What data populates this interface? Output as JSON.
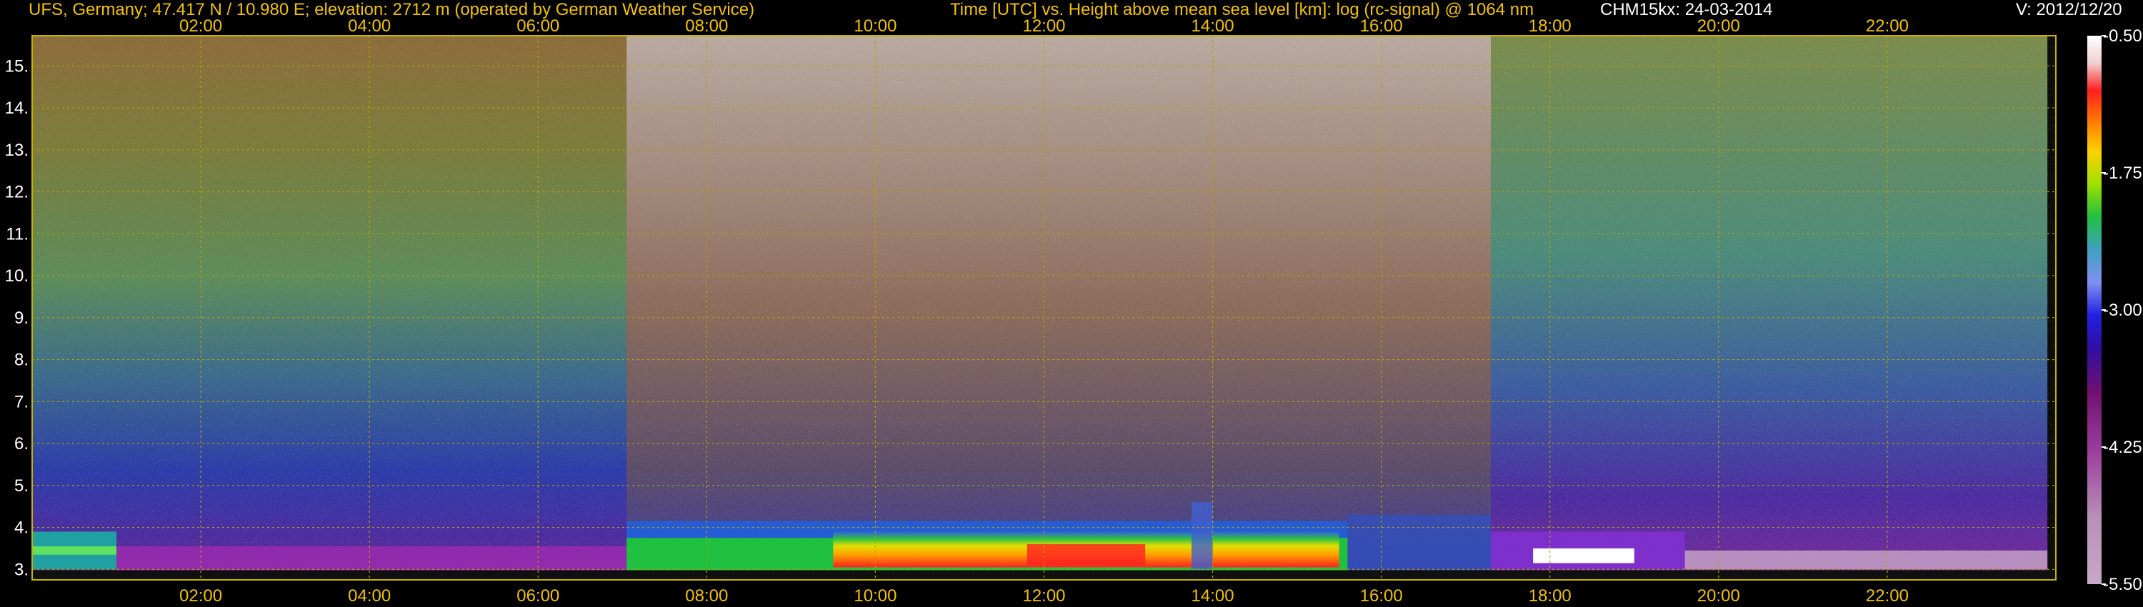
{
  "header": {
    "station": "UFS, Germany; 47.417 N / 10.980 E; elevation: 2712 m  (operated by German Weather Service)",
    "description": "Time [UTC] vs. Height above mean sea level [km]: log (rc-signal) @ 1064 nm",
    "instrument_date": "CHM15kx: 24-03-2014",
    "version": "V: 2012/12/20"
  },
  "colors": {
    "axis_text": "#f2c200",
    "frame": "#c8b400",
    "grid": "#b8a000",
    "y_tick_text": "#ffffff"
  },
  "chart_data": {
    "type": "heatmap",
    "title": "Time [UTC] vs. Height above mean sea level [km]: log (rc-signal) @ 1064 nm",
    "xlabel": "Time [UTC]",
    "ylabel": "Height above mean sea level [km]",
    "x_ticks": [
      "02:00",
      "04:00",
      "06:00",
      "08:00",
      "10:00",
      "12:00",
      "14:00",
      "16:00",
      "18:00",
      "20:00",
      "22:00"
    ],
    "x_tick_hours": [
      2,
      4,
      6,
      8,
      10,
      12,
      14,
      16,
      18,
      20,
      22
    ],
    "xlim_hours": [
      0,
      24
    ],
    "y_ticks": [
      "3.",
      "4.",
      "5.",
      "6.",
      "7.",
      "8.",
      "9.",
      "10.",
      "11.",
      "12.",
      "13.",
      "14.",
      "15."
    ],
    "y_tick_values": [
      3,
      4,
      5,
      6,
      7,
      8,
      9,
      10,
      11,
      12,
      13,
      14,
      15
    ],
    "ylim_km": [
      2.75,
      15.72
    ],
    "grid": true,
    "colorbar": {
      "ticks": [
        "-0.50",
        "-1.75",
        "-3.00",
        "-4.25",
        "-5.50"
      ],
      "tick_values": [
        -0.5,
        -1.75,
        -3.0,
        -4.25,
        -5.5
      ],
      "range": [
        -5.5,
        -0.5
      ]
    }
  }
}
